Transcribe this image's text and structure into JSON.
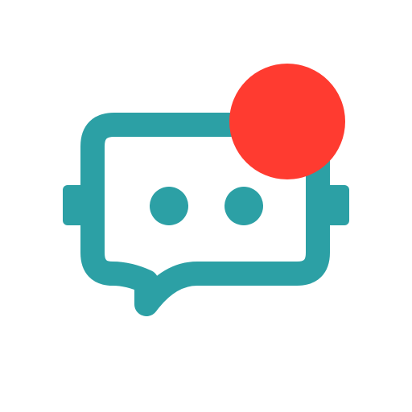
{
  "app_icon": {
    "icon": "chat-bot-icon",
    "badge_icon": "notification-dot-icon",
    "colors": {
      "teal": "#2CA0A5",
      "badge_red": "#FF3B30",
      "background": "#FFFFFF"
    }
  }
}
